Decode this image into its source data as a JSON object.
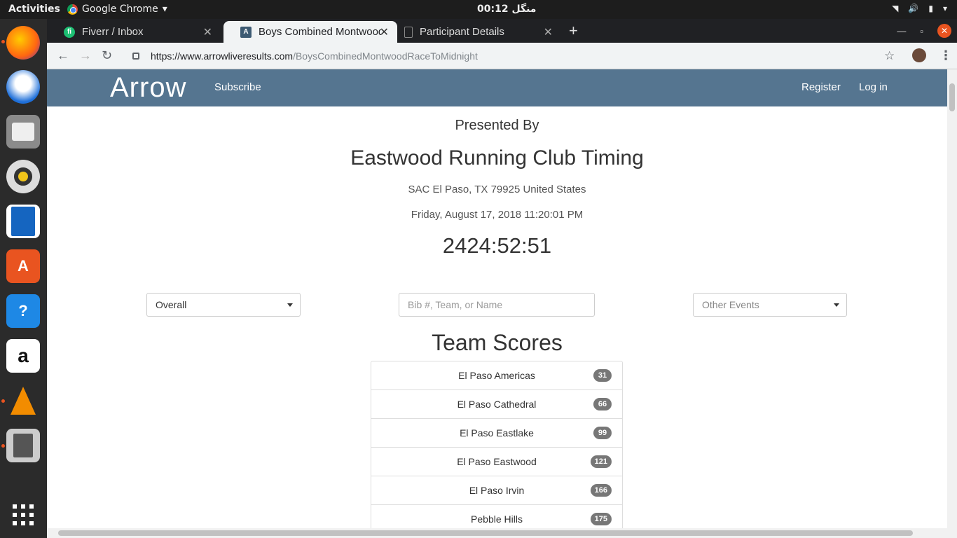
{
  "system": {
    "activities": "Activities",
    "app_menu": "Google Chrome",
    "clock": "منگل 00:12"
  },
  "dock": {
    "items": [
      "firefox-icon",
      "thunderbird-icon",
      "files-icon",
      "rhythmbox-icon",
      "writer-icon",
      "software-icon",
      "help-icon",
      "amazon-icon",
      "vlc-icon",
      "installer-icon"
    ]
  },
  "browser": {
    "tabs": [
      {
        "label": "Fiverr / Inbox"
      },
      {
        "label": "Boys Combined Montwood"
      },
      {
        "label": "Participant Details"
      }
    ],
    "url_host": "https://www.arrowliveresults.com",
    "url_path": "/BoysCombinedMontwoodRaceToMidnight"
  },
  "site": {
    "logo": "Arrow",
    "subscribe": "Subscribe",
    "register": "Register",
    "login": "Log in"
  },
  "event": {
    "presented_by": "Presented By",
    "organizer": "Eastwood Running Club Timing",
    "address": "SAC El Paso, TX 79925 United States",
    "datetime": "Friday, August 17, 2018 11:20:01 PM",
    "elapsed": "2424:52:51"
  },
  "filters": {
    "view_select": "Overall",
    "search_placeholder": "Bib #, Team, or Name",
    "events_select": "Other Events"
  },
  "team_scores": {
    "heading": "Team Scores",
    "rows": [
      {
        "team": "El Paso Americas",
        "score": "31"
      },
      {
        "team": "El Paso Cathedral",
        "score": "66"
      },
      {
        "team": "El Paso Eastlake",
        "score": "99"
      },
      {
        "team": "El Paso Eastwood",
        "score": "121"
      },
      {
        "team": "El Paso Irvin",
        "score": "166"
      },
      {
        "team": "Pebble Hills",
        "score": "175"
      }
    ]
  },
  "colors": {
    "nav_bar": "#557590",
    "badge": "#777777",
    "ubuntu_orange": "#e95420"
  }
}
